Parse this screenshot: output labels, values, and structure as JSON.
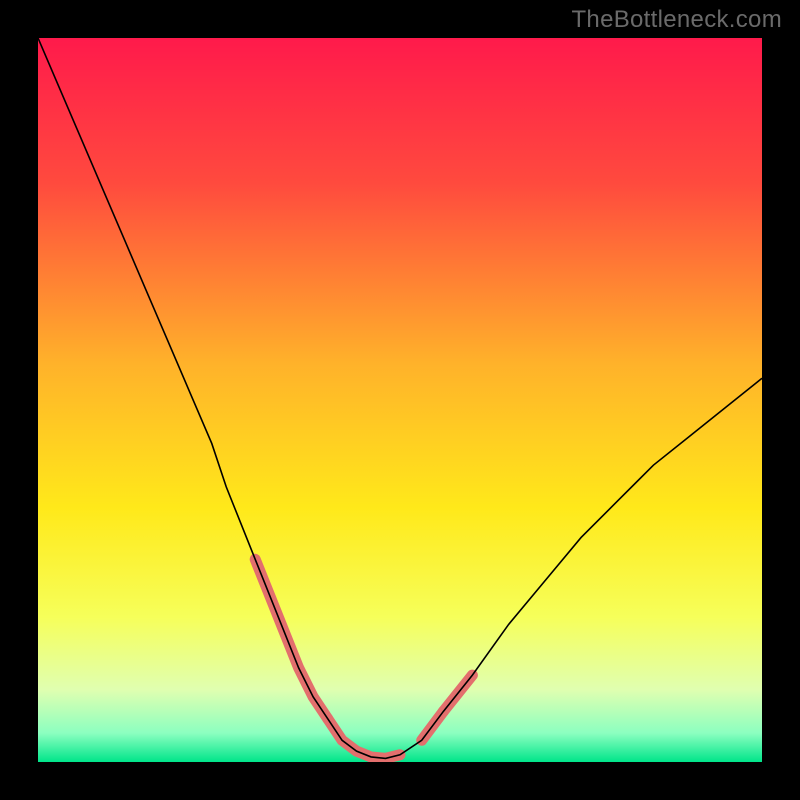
{
  "watermark": "TheBottleneck.com",
  "chart_data": {
    "type": "line",
    "title": "",
    "xlabel": "",
    "ylabel": "",
    "xlim": [
      0,
      100
    ],
    "ylim": [
      0,
      100
    ],
    "grid": false,
    "background_gradient_stops": [
      {
        "offset": 0,
        "color": "#ff1a4b"
      },
      {
        "offset": 20,
        "color": "#ff4a3e"
      },
      {
        "offset": 45,
        "color": "#ffb22a"
      },
      {
        "offset": 65,
        "color": "#ffe91a"
      },
      {
        "offset": 80,
        "color": "#f6ff5a"
      },
      {
        "offset": 90,
        "color": "#e0ffb0"
      },
      {
        "offset": 96,
        "color": "#8cffc0"
      },
      {
        "offset": 100,
        "color": "#00e58a"
      }
    ],
    "series": [
      {
        "name": "bottleneck-curve",
        "color": "#000000",
        "width": 1.6,
        "x": [
          0,
          3,
          6,
          9,
          12,
          15,
          18,
          21,
          24,
          26,
          28,
          30,
          32,
          34,
          36,
          38,
          40,
          42,
          44,
          46,
          48,
          50,
          53,
          56,
          60,
          65,
          70,
          75,
          80,
          85,
          90,
          95,
          100
        ],
        "values": [
          100,
          93,
          86,
          79,
          72,
          65,
          58,
          51,
          44,
          38,
          33,
          28,
          23,
          18,
          13,
          9,
          6,
          3,
          1.5,
          0.7,
          0.5,
          1,
          3,
          7,
          12,
          19,
          25,
          31,
          36,
          41,
          45,
          49,
          53
        ]
      },
      {
        "name": "highlight-segments",
        "color": "#e36f6d",
        "width": 11,
        "linecap": "round",
        "segments": [
          {
            "x": [
              30,
              32,
              34,
              36,
              38,
              40
            ],
            "values": [
              28,
              23,
              18,
              13,
              9,
              6
            ]
          },
          {
            "x": [
              40,
              42,
              44,
              46,
              48,
              50
            ],
            "values": [
              6,
              3,
              1.5,
              0.7,
              0.5,
              1
            ]
          },
          {
            "x": [
              53,
              56
            ],
            "values": [
              3,
              7
            ]
          },
          {
            "x": [
              56,
              60
            ],
            "values": [
              7,
              12
            ]
          }
        ]
      }
    ]
  }
}
